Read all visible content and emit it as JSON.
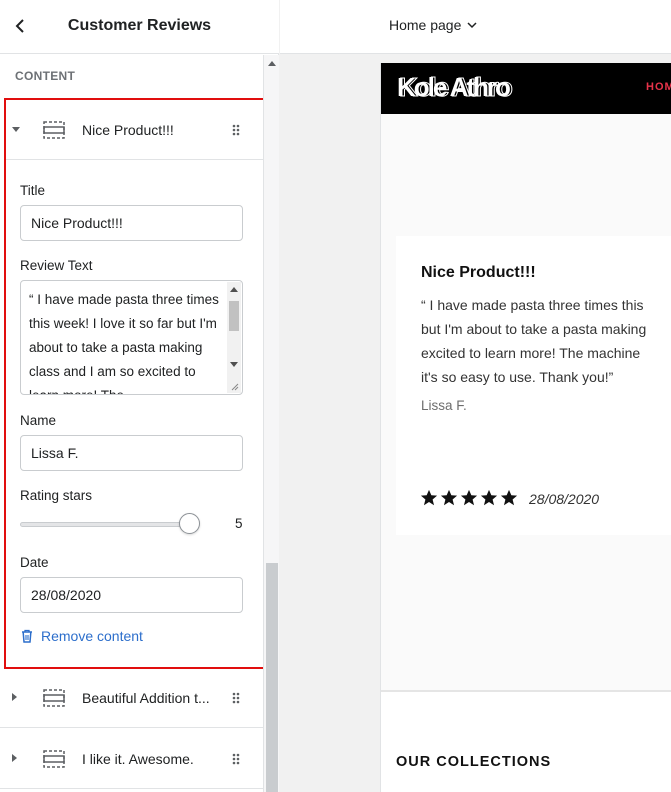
{
  "sidebar": {
    "title": "Customer Reviews",
    "section_label": "CONTENT",
    "expanded_block": {
      "label": "Nice Product!!!",
      "fields": {
        "title_label": "Title",
        "title_value": "Nice Product!!!",
        "review_label": "Review Text",
        "review_value": "“ I have made pasta three times this week! I love it so far but I'm about to take a pasta making class and I am so excited to learn more! The",
        "name_label": "Name",
        "name_value": "Lissa F.",
        "rating_label": "Rating stars",
        "rating_value": "5",
        "rating_fraction": 1.0,
        "date_label": "Date",
        "date_value": "28/08/2020"
      },
      "remove_label": "Remove content"
    },
    "blocks": [
      {
        "label": "Beautiful Addition t..."
      },
      {
        "label": "I like it. Awesome."
      }
    ]
  },
  "preview": {
    "page_selector": "Home page",
    "logo": "Kole Athro",
    "nav_home": "HOM",
    "review": {
      "title": "Nice Product!!!",
      "lines": [
        "“ I have made pasta three times this",
        "but I'm about to take a pasta making",
        "excited to learn more! The machine",
        "it's so easy to use. Thank you!”"
      ],
      "name": "Lissa F.",
      "stars": 5,
      "date": "28/08/2020"
    },
    "collections_heading": "OUR COLLECTIONS"
  },
  "colors": {
    "highlight_border": "#e10e0e",
    "link_blue": "#2c6ecb",
    "nav_accent": "#e8334a"
  },
  "icons": [
    "back-chevron-icon",
    "caret-down-icon",
    "caret-right-icon",
    "block-icon",
    "drag-handle-icon",
    "trash-icon",
    "chevron-down-icon",
    "star-icon"
  ]
}
